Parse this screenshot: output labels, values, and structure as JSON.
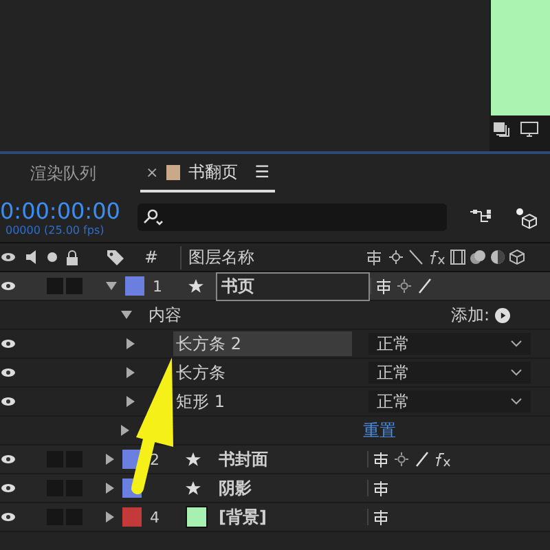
{
  "tabs": [
    {
      "label": "渲染队列",
      "selected": false
    },
    {
      "label": "书翻页",
      "selected": true,
      "close": "×",
      "menu": "☰"
    }
  ],
  "timecode": "0:00:00:00",
  "frame_info": "00000 (25.00 fps)",
  "header": {
    "number": "#",
    "name": "图层名称"
  },
  "add_label": "添加:",
  "reset_label": "重置",
  "rows": [
    {
      "kind": "layer",
      "number": "1",
      "name": "书页",
      "color": "#6a7fe0",
      "expanded": true,
      "selected": true,
      "switches": [
        {
          "kind": "shy"
        },
        {
          "kind": "collapse"
        },
        {
          "kind": "quality"
        }
      ],
      "star": true
    },
    {
      "kind": "group",
      "name": "内容",
      "expanded": true
    },
    {
      "kind": "property",
      "name": "长方条 2",
      "mode": "正常",
      "selected": true
    },
    {
      "kind": "property",
      "name": "长方条",
      "mode": "正常",
      "selected": false
    },
    {
      "kind": "property",
      "name": "矩形 1",
      "mode": "正常",
      "selected": false
    },
    {
      "kind": "transform"
    },
    {
      "kind": "layer",
      "number": "2",
      "name": "书封面",
      "color": "#6a7fe0",
      "expanded": false,
      "selected": false,
      "switches": [
        {
          "kind": "shy"
        },
        {
          "kind": "collapse"
        },
        {
          "kind": "quality"
        },
        {
          "kind": "fx"
        }
      ],
      "star": true
    },
    {
      "kind": "layer",
      "name": "阴影",
      "color": "#6a7fe0",
      "expanded": false,
      "selected": false,
      "switches": [
        {
          "kind": "shy"
        }
      ],
      "star": true
    },
    {
      "kind": "layer",
      "number": "4",
      "name": "[背景]",
      "color": "#c43a3a",
      "expanded": false,
      "selected": false,
      "switches": [
        {
          "kind": "shy"
        }
      ],
      "star": false,
      "solid": true
    }
  ]
}
